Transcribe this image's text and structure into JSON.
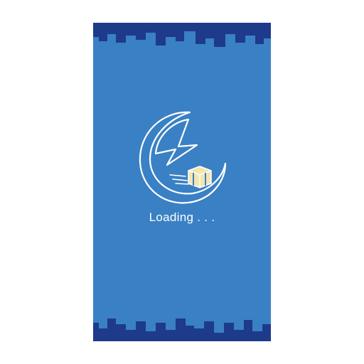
{
  "splash": {
    "loading_text": "Loading . . ."
  },
  "colors": {
    "background": "#3a80c4",
    "skyline": "#1e3a8a",
    "logo_stroke": "#ffffff",
    "package": "#f2e6b0"
  },
  "icons": {
    "logo": "crescent-delivery-logo",
    "package": "package-box-icon"
  }
}
